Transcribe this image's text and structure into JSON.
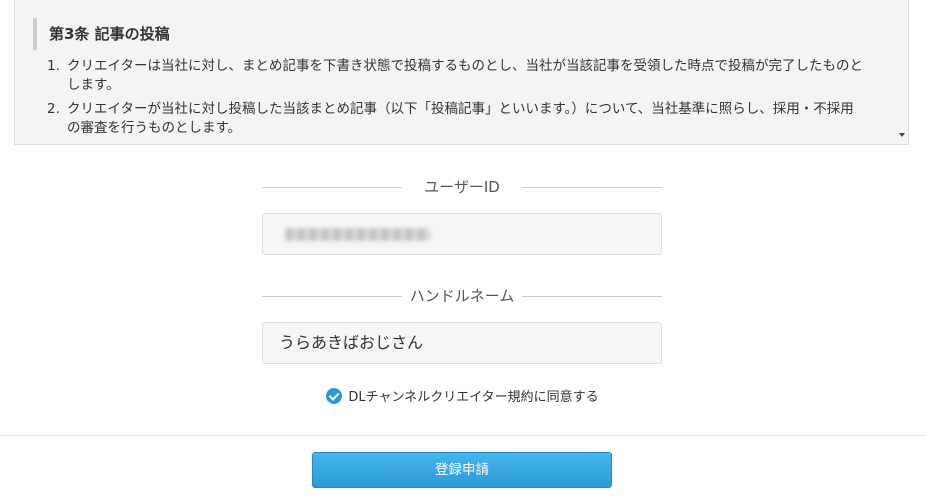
{
  "terms": {
    "heading": "第3条 記事の投稿",
    "items": [
      {
        "num": "1.",
        "text": "クリエイターは当社に対し、まとめ記事を下書き状態で投稿するものとし、当社が当該記事を受領した時点で投稿が完了したものとします。"
      },
      {
        "num": "2.",
        "text": "クリエイターが当社に対し投稿した当該まとめ記事（以下「投稿記事」といいます。）について、当社基準に照らし、採用・不採用の審査を行うものとします。"
      }
    ]
  },
  "form": {
    "user_id_label": "ユーザーID",
    "user_id_value": "",
    "handle_label": "ハンドルネーム",
    "handle_value": "うらあきばおじさん",
    "consent_label": "DLチャンネルクリエイター規約に同意する",
    "consent_checked": true,
    "submit_label": "登録申請"
  },
  "icons": {
    "consent_check": "check-circle-icon",
    "scroll": "scroll-down-arrow-icon"
  },
  "colors": {
    "accent": "#2b9ad8",
    "button_top": "#46b6ee"
  }
}
